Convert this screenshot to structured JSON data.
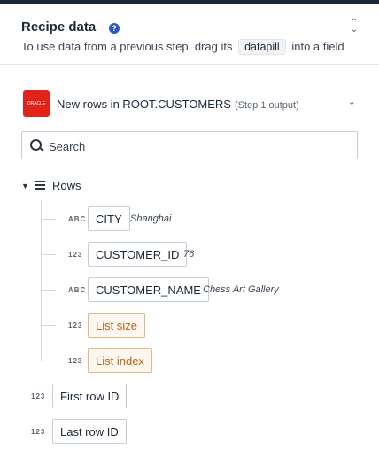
{
  "header": {
    "title": "Recipe data",
    "help_icon": "question-circle-icon",
    "subtitle_before": "To use data from a previous step, drag its",
    "subtitle_pill": "datapill",
    "subtitle_after": "into a field"
  },
  "step": {
    "app_logo": "oracle-logo",
    "logo_text": "ORACLE",
    "title": "New rows in ROOT.CUSTOMERS",
    "subtitle": "(Step 1 output)"
  },
  "search": {
    "placeholder": "Search",
    "value": ""
  },
  "tree": {
    "root_label": "Rows",
    "fields": [
      {
        "type": "ABC",
        "label": "CITY",
        "sample": "Shanghai"
      },
      {
        "type": "123",
        "label": "CUSTOMER_ID",
        "sample": "76"
      },
      {
        "type": "ABC",
        "label": "CUSTOMER_NAME",
        "sample": "Chess Art Gallery"
      },
      {
        "type": "123",
        "label": "List size",
        "sample": ""
      },
      {
        "type": "123",
        "label": "List index",
        "sample": ""
      }
    ],
    "top_fields": [
      {
        "type": "123",
        "label": "First row ID"
      },
      {
        "type": "123",
        "label": "Last row ID"
      }
    ]
  },
  "colors": {
    "accent": "#2b59c3",
    "oracle_red": "#e2231a",
    "meta_pill": "#b8651b"
  }
}
